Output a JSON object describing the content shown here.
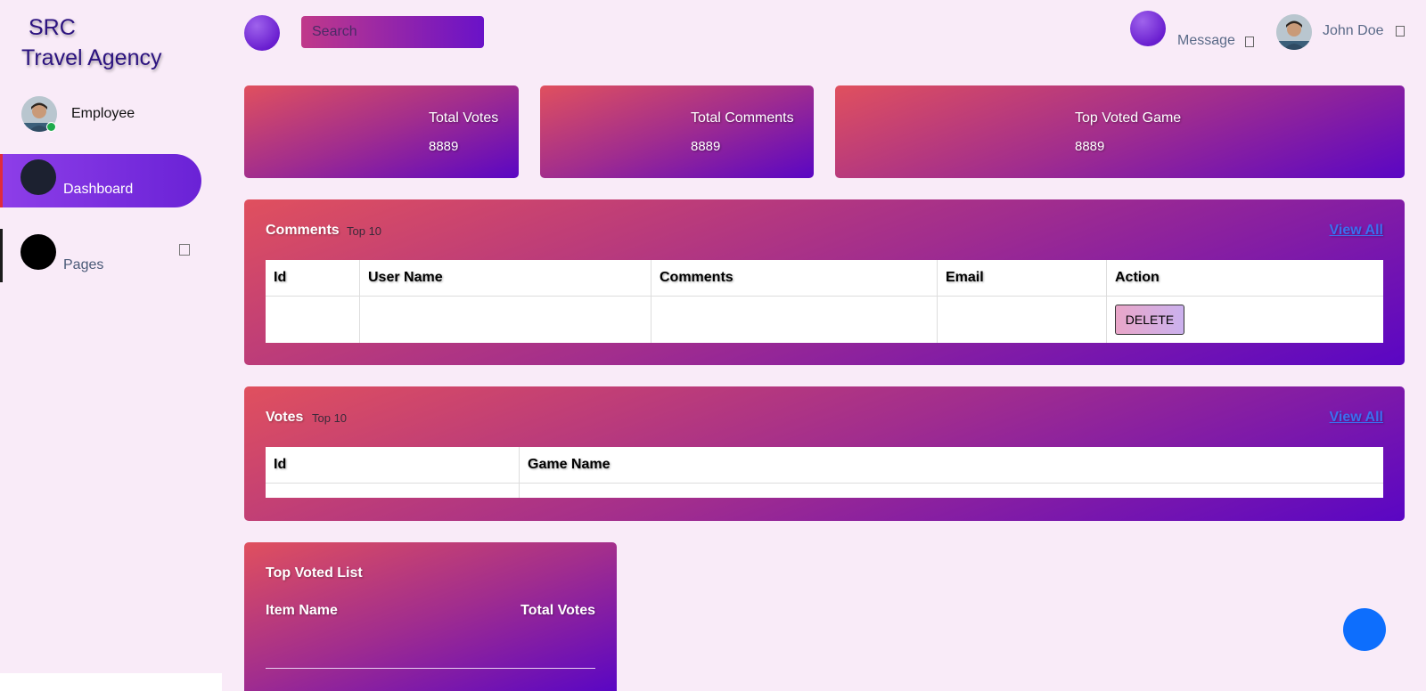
{
  "brand": {
    "line1": "SRC",
    "line2": "Travel Agency"
  },
  "sidebar": {
    "profile_name": "Employee",
    "items": [
      {
        "label": "Dashboard",
        "active": true
      },
      {
        "label": "Pages",
        "active": false
      }
    ]
  },
  "topbar": {
    "search_placeholder": "Search",
    "message_label": "Message",
    "user_name": "John Doe"
  },
  "stats": [
    {
      "title": "Total Votes",
      "value": "8889"
    },
    {
      "title": "Total Comments",
      "value": "8889"
    },
    {
      "title": "Top Voted Game",
      "value": "8889"
    }
  ],
  "comments_panel": {
    "title": "Comments",
    "subtitle": "Top 10",
    "view_all": "View All",
    "columns": [
      "Id",
      "User Name",
      "Comments",
      "Email",
      "Action"
    ],
    "delete_label": "DELETE"
  },
  "votes_panel": {
    "title": "Votes",
    "subtitle": "Top 10",
    "view_all": "View All",
    "columns": [
      "Id",
      "Game Name"
    ]
  },
  "top_voted_list": {
    "title": "Top Voted List",
    "col_item": "Item Name",
    "col_votes": "Total Votes"
  },
  "colors": {
    "accent_start": "#e0505e",
    "accent_mid": "#a12d8e",
    "accent_end": "#5a06c4",
    "background": "#f9ebf8",
    "fab": "#0d6efd",
    "link": "#3c6ff0"
  }
}
